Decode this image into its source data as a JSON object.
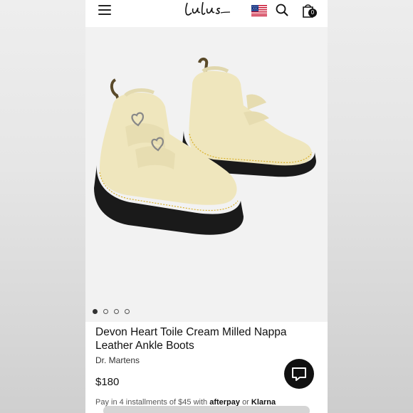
{
  "header": {
    "logo_text": "Lulus",
    "bag_count": "0"
  },
  "icons": {
    "menu": "hamburger-menu-icon",
    "flag": "us-flag-icon",
    "search": "search-icon",
    "bag": "shopping-bag-icon",
    "chat": "chat-icon"
  },
  "gallery": {
    "image_alt": "Devon Heart Toile Cream Milled Nappa Leather Ankle Boots",
    "dots_count": 4,
    "active_dot": 0
  },
  "product": {
    "title_line1": "Devon Heart Toile Cream Milled Nappa",
    "title_line2": "Leather Ankle Boots",
    "brand": "Dr. Martens",
    "price": "$180",
    "installments_prefix": "Pay in 4 installments of $45 with",
    "afterpay": "afterpay",
    "or": "or",
    "klarna": "Klarna"
  },
  "colors": {
    "boot_cream": "#efe6bd",
    "sole_black": "#1a1a1a",
    "stitch_yellow": "#d9b02a",
    "gallery_bg": "#f2f2f2"
  }
}
